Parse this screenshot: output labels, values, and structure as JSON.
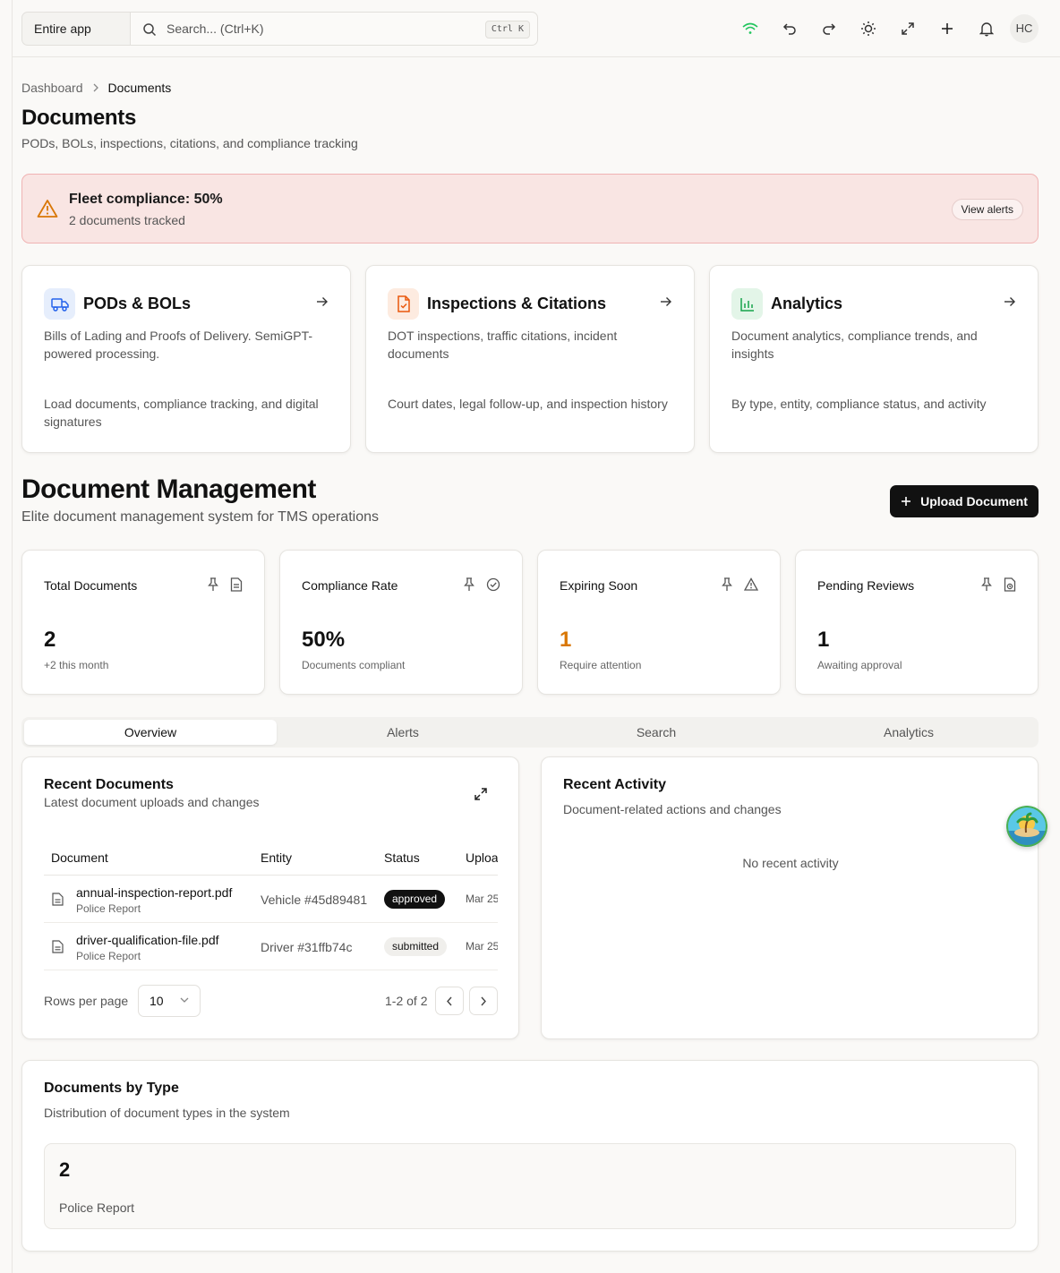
{
  "topbar": {
    "scope_label": "Entire app",
    "search_placeholder": "Search... (Ctrl+K)",
    "search_shortcut": "Ctrl K",
    "user_initials": "HC",
    "icons": [
      "wifi-icon",
      "undo-icon",
      "redo-icon",
      "sun-icon",
      "expand-icon",
      "plus-icon",
      "bell-icon"
    ]
  },
  "breadcrumb": {
    "items": [
      "Dashboard",
      "Documents"
    ]
  },
  "page": {
    "title": "Documents",
    "subtitle": "PODs, BOLs, inspections, citations, and compliance tracking"
  },
  "alert": {
    "title": "Fleet compliance: 50%",
    "detail": "2 documents tracked",
    "button": "View alerts"
  },
  "features": [
    {
      "title": "PODs & BOLs",
      "desc": "Bills of Lading and Proofs of Delivery. SemiGPT-powered processing.",
      "detail": "Load documents, compliance tracking, and digital signatures",
      "icon": "truck-icon",
      "color": "#2563eb"
    },
    {
      "title": "Inspections & Citations",
      "desc": "DOT inspections, traffic citations, incident documents",
      "detail": "Court dates, legal follow-up, and inspection history",
      "icon": "file-check-icon",
      "color": "#ea580c"
    },
    {
      "title": "Analytics",
      "desc": "Document analytics, compliance trends, and insights",
      "detail": "By type, entity, compliance status, and activity",
      "icon": "bar-chart-icon",
      "color": "#16a34a"
    }
  ],
  "management": {
    "title": "Document Management",
    "subtitle": "Elite document management system for TMS operations",
    "upload_button": "Upload Document"
  },
  "stats": [
    {
      "label": "Total Documents",
      "value": "2",
      "hint": "+2 this month",
      "icon": "file-text-icon"
    },
    {
      "label": "Compliance Rate",
      "value": "50%",
      "hint": "Documents compliant",
      "icon": "check-circle-icon"
    },
    {
      "label": "Expiring Soon",
      "value": "1",
      "hint": "Require attention",
      "icon": "warning-icon",
      "value_color": "#d97706"
    },
    {
      "label": "Pending Reviews",
      "value": "1",
      "hint": "Awaiting approval",
      "icon": "file-clock-icon"
    }
  ],
  "tabs": [
    "Overview",
    "Alerts",
    "Search",
    "Analytics"
  ],
  "recent_documents": {
    "title": "Recent Documents",
    "subtitle": "Latest document uploads and changes",
    "columns": [
      "Document",
      "Entity",
      "Status",
      "Uploa"
    ],
    "rows": [
      {
        "name": "annual-inspection-report.pdf",
        "type": "Police Report",
        "entity": "Vehicle #45d89481",
        "status": "approved",
        "uploaded": "Mar 25"
      },
      {
        "name": "driver-qualification-file.pdf",
        "type": "Police Report",
        "entity": "Driver #31ffb74c",
        "status": "submitted",
        "uploaded": "Mar 25"
      }
    ],
    "rows_per_page_label": "Rows per page",
    "rows_per_page": "10",
    "range": "1-2 of 2"
  },
  "recent_activity": {
    "title": "Recent Activity",
    "subtitle": "Document-related actions and changes",
    "empty": "No recent activity"
  },
  "by_type": {
    "title": "Documents by Type",
    "subtitle": "Distribution of document types in the system",
    "items": [
      {
        "count": "2",
        "label": "Police Report"
      }
    ]
  }
}
